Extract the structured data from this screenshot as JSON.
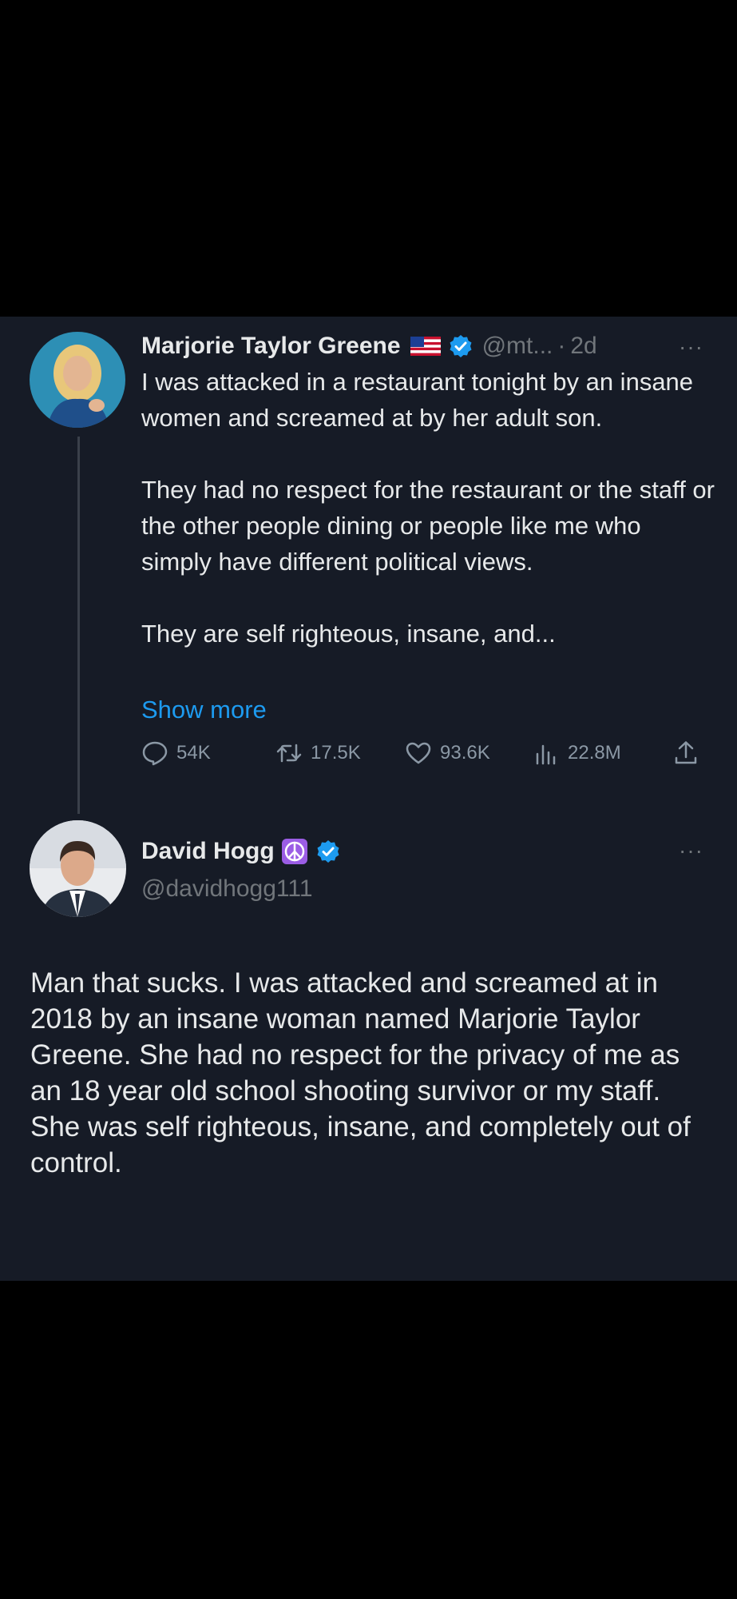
{
  "colors": {
    "background": "#000000",
    "panel": "#161b26",
    "text_primary": "#e7e9ea",
    "text_secondary": "#71767b",
    "link": "#1d9bf0",
    "verified": "#1d9bf0",
    "peace_badge": "#9b5de5"
  },
  "tweet1": {
    "display_name": "Marjorie Taylor Greene",
    "flag_icon": "us-flag-icon",
    "verified_icon": "verified-badge-icon",
    "handle": "@mt...",
    "separator": "·",
    "time": "2d",
    "more_icon": "more-options-icon",
    "more_label": "···",
    "body": [
      "I was attacked in a restaurant tonight by an insane women and screamed at by her adult son.",
      "They had no respect for the restaurant or the staff or the other people dining or people like me who simply have different political views.",
      "They are self righteous, insane, and..."
    ],
    "show_more": "Show more",
    "actions": {
      "reply": {
        "icon": "reply-icon",
        "count": "54K"
      },
      "retweet": {
        "icon": "retweet-icon",
        "count": "17.5K"
      },
      "like": {
        "icon": "heart-icon",
        "count": "93.6K"
      },
      "views": {
        "icon": "views-icon",
        "count": "22.8M"
      },
      "share": {
        "icon": "share-icon"
      }
    }
  },
  "tweet2": {
    "display_name": "David Hogg",
    "badge_icon": "peace-sign-icon",
    "verified_icon": "verified-badge-icon",
    "handle": "@davidhogg111",
    "more_icon": "more-options-icon",
    "more_label": "···",
    "body": [
      "Man that sucks. I was attacked and screamed at in 2018 by an insane woman named Marjorie Taylor Greene. She had no respect for the privacy of me as an 18 year old school shooting survivor or my staff.",
      "She was self righteous, insane, and completely out of control."
    ]
  }
}
